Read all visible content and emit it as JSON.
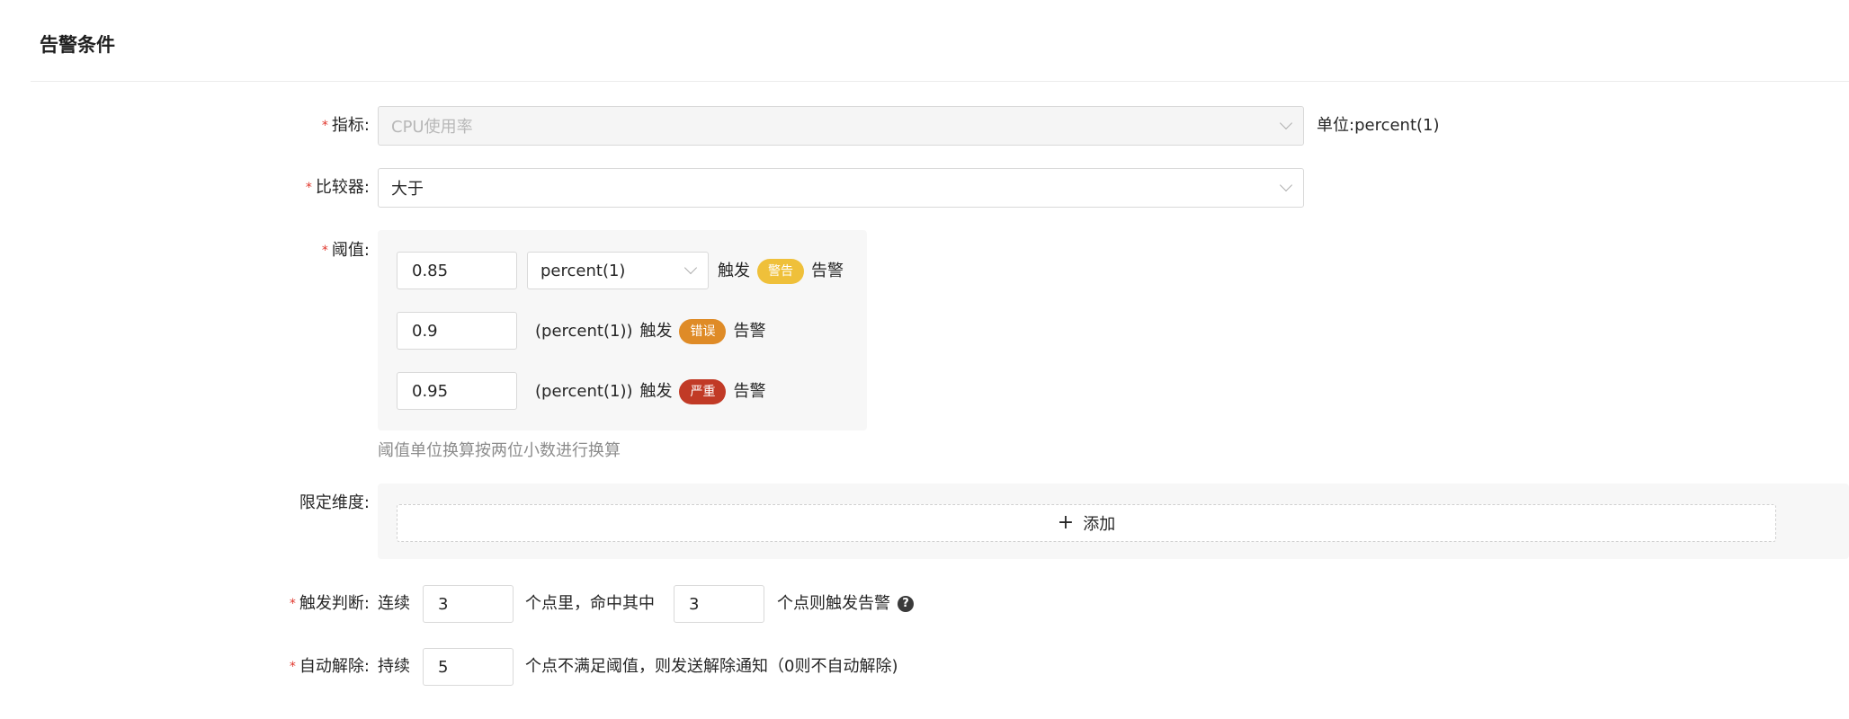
{
  "section_title": "告警条件",
  "metric": {
    "label": "指标:",
    "value": "CPU使用率",
    "unit_label": "单位:",
    "unit_value": "percent(1)"
  },
  "comparator": {
    "label": "比较器:",
    "value": "大于"
  },
  "threshold": {
    "label": "阈值:",
    "rows": [
      {
        "value": "0.85",
        "unit": "percent(1)",
        "trigger": "触发",
        "tag": "警告",
        "tag_color": "#efc03a",
        "suffix": "告警"
      },
      {
        "value": "0.9",
        "unit": "(percent(1))",
        "trigger": "触发",
        "tag": "错误",
        "tag_color": "#df8b27",
        "suffix": "告警"
      },
      {
        "value": "0.95",
        "unit": "(percent(1))",
        "trigger": "触发",
        "tag": "严重",
        "tag_color": "#c13a26",
        "suffix": "告警"
      }
    ],
    "help": "阈值单位换算按两位小数进行换算"
  },
  "dimension": {
    "label": "限定维度:",
    "add_label": "添加",
    "add_icon": "plus-icon"
  },
  "trigger_judge": {
    "label": "触发判断:",
    "prefix": "连续",
    "points": "3",
    "middle": "个点里，命中其中",
    "hits": "3",
    "suffix": "个点则触发告警",
    "help_icon": "question-circle-icon"
  },
  "auto_resolve": {
    "label": "自动解除:",
    "prefix": "持续",
    "points": "5",
    "suffix": "个点不满足阈值，则发送解除通知（0则不自动解除)"
  }
}
